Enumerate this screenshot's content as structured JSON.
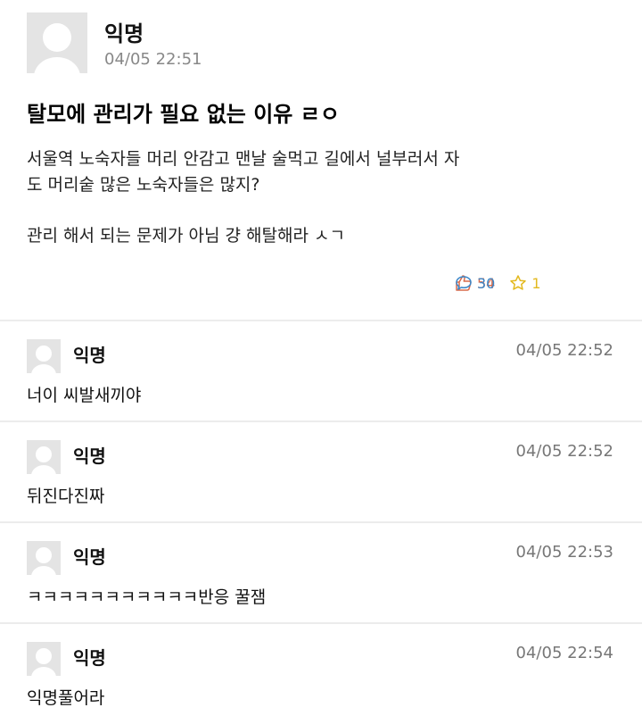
{
  "post": {
    "author": "익명",
    "timestamp": "04/05 22:51",
    "title": "탈모에 관리가 필요 없는 이유 ㄹㅇ",
    "body_line1": "서울역 노숙자들 머리 안감고 맨날 술먹고 길에서 널부러서 자",
    "body_line2": "도 머리숱 많은 노숙자들은 많지?",
    "body_line3": "관리 해서 되는 문제가 아님 걍 해탈해라 ㅅㄱ",
    "likes": "54",
    "comments_count": "30",
    "scraps": "1"
  },
  "comments": [
    {
      "author": "익명",
      "timestamp": "04/05 22:52",
      "text": "너이 씨발새끼야"
    },
    {
      "author": "익명",
      "timestamp": "04/05 22:52",
      "text": "뒤진다진짜"
    },
    {
      "author": "익명",
      "timestamp": "04/05 22:53",
      "text": "ㅋㅋㅋㅋㅋㅋㅋㅋㅋㅋㅋ반응 꿀잼"
    },
    {
      "author": "익명",
      "timestamp": "04/05 22:54",
      "text": "익명풀어라"
    }
  ],
  "colors": {
    "like": "#d86a4a",
    "comment": "#3a86c8",
    "scrap": "#e3b91f"
  },
  "icons": {
    "like": "thumbs-up-icon",
    "comment": "speech-bubble-icon",
    "scrap": "star-icon",
    "avatar": "default-user-icon"
  }
}
